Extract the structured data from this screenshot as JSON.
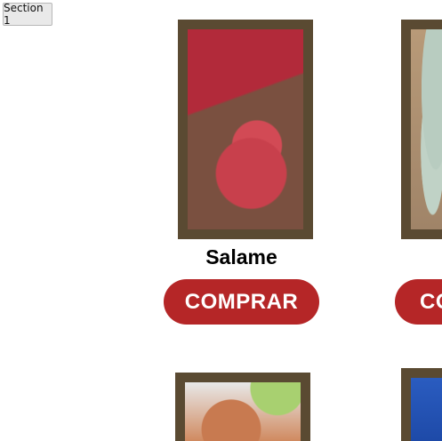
{
  "section_button": {
    "label": "Section 1"
  },
  "products": [
    {
      "name": "Salame",
      "button": "COMPRAR",
      "image": "salami"
    },
    {
      "name": "",
      "button": "COMPRAR",
      "image": "eggs"
    },
    {
      "name": "",
      "button": "",
      "image": "fried-pork"
    },
    {
      "name": "",
      "button": "",
      "image": "milk-bottle"
    }
  ],
  "colors": {
    "button": "#b52627",
    "frame": "#5a4a32"
  }
}
